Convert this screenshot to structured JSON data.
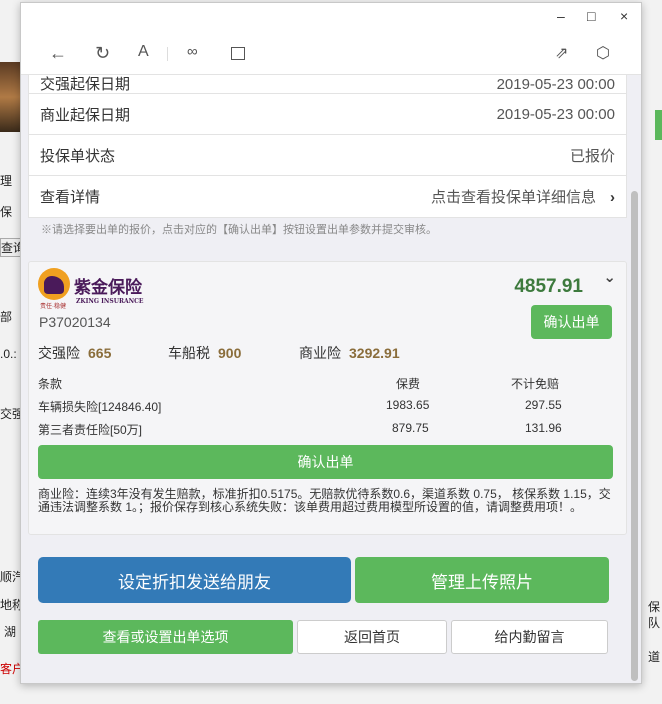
{
  "background": {
    "fragments": [
      "理",
      "保",
      "查询",
      "部",
      ".0.:",
      "交强",
      "顺汽",
      "地称",
      "湖",
      "客户",
      "保",
      "队",
      "道"
    ]
  },
  "window": {
    "controls": {
      "minimize": "–",
      "maximize": "□",
      "close": "×"
    }
  },
  "toolbar": {
    "icons": [
      "back-arrow-icon",
      "refresh-icon",
      "font-icon",
      "link-icon",
      "window-icon",
      "share-icon",
      "cube-icon"
    ]
  },
  "info_rows": [
    {
      "label": "交强起保日期",
      "value": "2019-05-23 00:00"
    },
    {
      "label": "商业起保日期",
      "value": "2019-05-23 00:00"
    },
    {
      "label": "投保单状态",
      "value": "已报价"
    },
    {
      "label": "查看详情",
      "value": "点击查看投保单详细信息"
    }
  ],
  "note": "※请选择要出单的报价，点击对应的【确认出单】按钮设置出单参数并提交审核。",
  "quote": {
    "company_name": "紫金保险",
    "company_name_en": "ZKING INSURANCE",
    "company_slogan": "责任·稳健",
    "code": "P37020134",
    "total": "4857.91",
    "confirm_label": "确认出单",
    "summary": [
      {
        "label": "交强险",
        "value": "665"
      },
      {
        "label": "车船税",
        "value": "900"
      },
      {
        "label": "商业险",
        "value": "3292.91"
      }
    ],
    "table": {
      "headers": [
        "条款",
        "保费",
        "不计免赔"
      ],
      "rows": [
        [
          "车辆损失险[124846.40]",
          "1983.65",
          "297.55"
        ],
        [
          "第三者责任险[50万]",
          "879.75",
          "131.96"
        ]
      ]
    },
    "confirm_wide_label": "确认出单",
    "description": "商业险：连续3年没有发生赔款，标准折扣0.5175。无赔款优待系数0.6，渠道系数 0.75， 核保系数 1.15，交通违法调整系数 1。；报价保存到核心系统失败：该单费用超过费用模型所设置的值，请调整费用项！。"
  },
  "actions": {
    "send_discount": "设定折扣发送给朋友",
    "manage_photos": "管理上传照片",
    "view_options": "查看或设置出单选项",
    "home": "返回首页",
    "message": "给内勤留言"
  }
}
